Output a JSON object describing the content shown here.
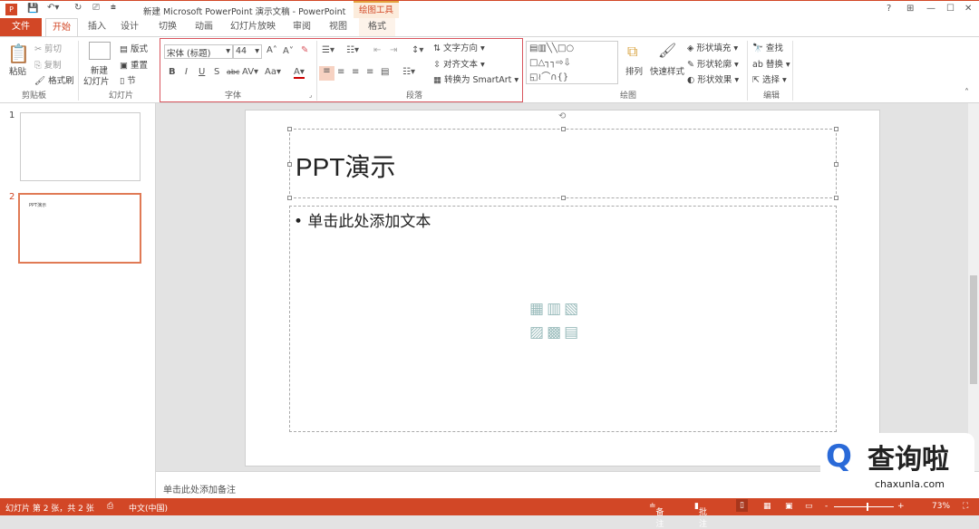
{
  "window": {
    "title": "新建 Microsoft PowerPoint 演示文稿 - PowerPoint",
    "context_tab": "绘图工具",
    "help": "?",
    "minimize": "—",
    "maximize": "☐",
    "close": "✕"
  },
  "tabs": [
    "文件",
    "开始",
    "插入",
    "设计",
    "切换",
    "动画",
    "幻灯片放映",
    "审阅",
    "视图",
    "格式"
  ],
  "ribbon": {
    "clipboard": {
      "paste": "粘贴",
      "cut": "剪切",
      "copy": "复制",
      "format_painter": "格式刷",
      "label": "剪贴板"
    },
    "slides": {
      "new_slide": "新建",
      "new_slide2": "幻灯片",
      "layout": "版式",
      "reset": "重置",
      "section": "节",
      "label": "幻灯片"
    },
    "font": {
      "name": "宋体 (标题)",
      "size": "44",
      "label": "字体"
    },
    "paragraph": {
      "text_direction": "文字方向",
      "align_text": "对齐文本",
      "smartart": "转换为 SmartArt",
      "label": "段落"
    },
    "drawing": {
      "arrange": "排列",
      "quick_styles": "快速样式",
      "fill": "形状填充",
      "outline": "形状轮廓",
      "effects": "形状效果",
      "label": "绘图"
    },
    "editing": {
      "find": "查找",
      "replace": "替换",
      "select": "选择",
      "label": "编辑"
    }
  },
  "thumbnails": [
    {
      "num": "1",
      "text": ""
    },
    {
      "num": "2",
      "text": "PPT演示"
    }
  ],
  "slide": {
    "title": "PPT演示",
    "body": "• 单击此处添加文本"
  },
  "notes": "单击此处添加备注",
  "status": {
    "slide": "幻灯片 第 2 张，共 2 张",
    "language": "中文(中国)",
    "notes": "备注",
    "comments": "批注",
    "zoom": "73%"
  },
  "watermark": {
    "text": "查询啦",
    "url": "chaxunla.com"
  },
  "colors": {
    "accent": "#d24726"
  }
}
